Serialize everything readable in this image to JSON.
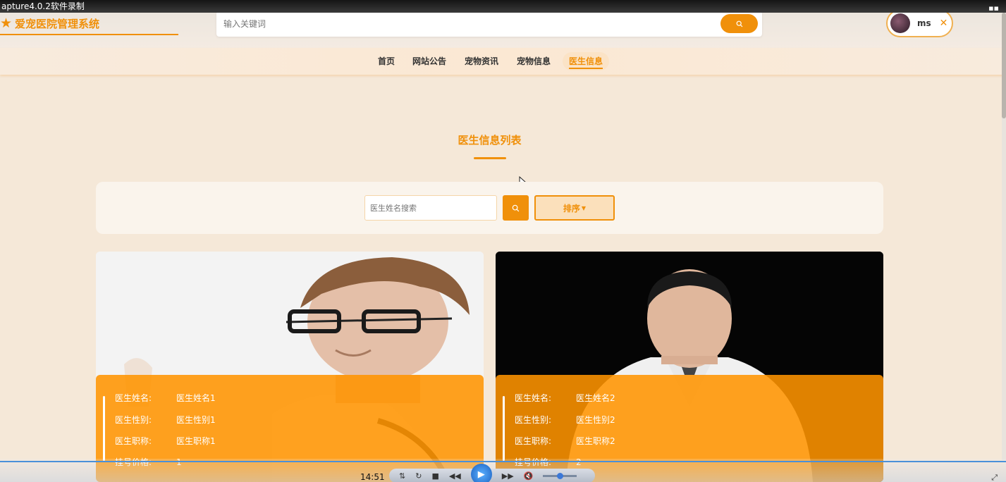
{
  "window": {
    "title": "apture4.0.2软件录制"
  },
  "header": {
    "site_title": "爱宠医院管理系统",
    "search_placeholder": "输入关键词",
    "user": {
      "name": "ms"
    }
  },
  "nav": {
    "items": [
      {
        "label": "首页"
      },
      {
        "label": "网站公告"
      },
      {
        "label": "宠物资讯"
      },
      {
        "label": "宠物信息"
      },
      {
        "label": "医生信息",
        "active": true
      }
    ]
  },
  "main": {
    "title": "医生信息列表",
    "filter": {
      "search_placeholder": "医生姓名搜索",
      "sort_label": "排序"
    },
    "cards": [
      {
        "rows": [
          {
            "label": "医生姓名:",
            "value": "医生姓名1"
          },
          {
            "label": "医生性别:",
            "value": "医生性别1"
          },
          {
            "label": "医生职称:",
            "value": "医生职称1"
          },
          {
            "label": "挂号价格:",
            "value": "1"
          }
        ]
      },
      {
        "rows": [
          {
            "label": "医生姓名:",
            "value": "医生姓名2"
          },
          {
            "label": "医生性别:",
            "value": "医生性别2"
          },
          {
            "label": "医生职称:",
            "value": "医生职称2"
          },
          {
            "label": "挂号价格:",
            "value": "2"
          }
        ]
      }
    ]
  },
  "player": {
    "time": "14:51"
  },
  "colors": {
    "accent": "#f0900a",
    "background": "#f5e8d8",
    "overlay": "#ff9400"
  }
}
